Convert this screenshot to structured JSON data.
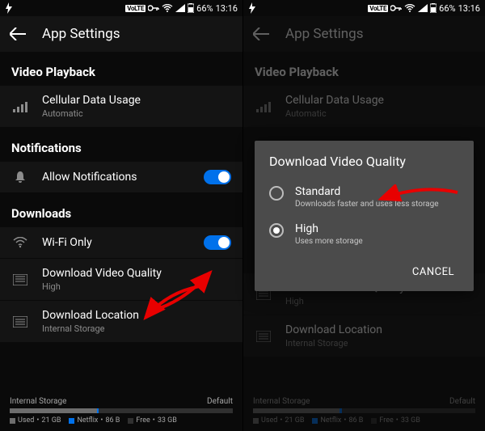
{
  "status": {
    "volte": "VoLTE",
    "battery": "66%",
    "time": "13:16"
  },
  "appbar": {
    "title": "App Settings"
  },
  "sections": {
    "video": {
      "header": "Video Playback",
      "cellular": {
        "label": "Cellular Data Usage",
        "value": "Automatic"
      }
    },
    "notifications": {
      "header": "Notifications",
      "allow": {
        "label": "Allow Notifications"
      }
    },
    "downloads": {
      "header": "Downloads",
      "wifi": {
        "label": "Wi-Fi Only"
      },
      "quality": {
        "label": "Download Video Quality",
        "value": "High"
      },
      "location": {
        "label": "Download Location",
        "value": "Internal Storage"
      }
    }
  },
  "storage": {
    "label": "Internal Storage",
    "default": "Default",
    "used": {
      "label": "Used",
      "value": "21 GB"
    },
    "netflix": {
      "label": "Netflix",
      "value": "86 B"
    },
    "free": {
      "label": "Free",
      "value": "33 GB"
    }
  },
  "dialog": {
    "title": "Download Video Quality",
    "options": {
      "standard": {
        "label": "Standard",
        "desc": "Downloads faster and uses less storage"
      },
      "high": {
        "label": "High",
        "desc": "Uses more storage"
      }
    },
    "cancel": "CANCEL"
  }
}
